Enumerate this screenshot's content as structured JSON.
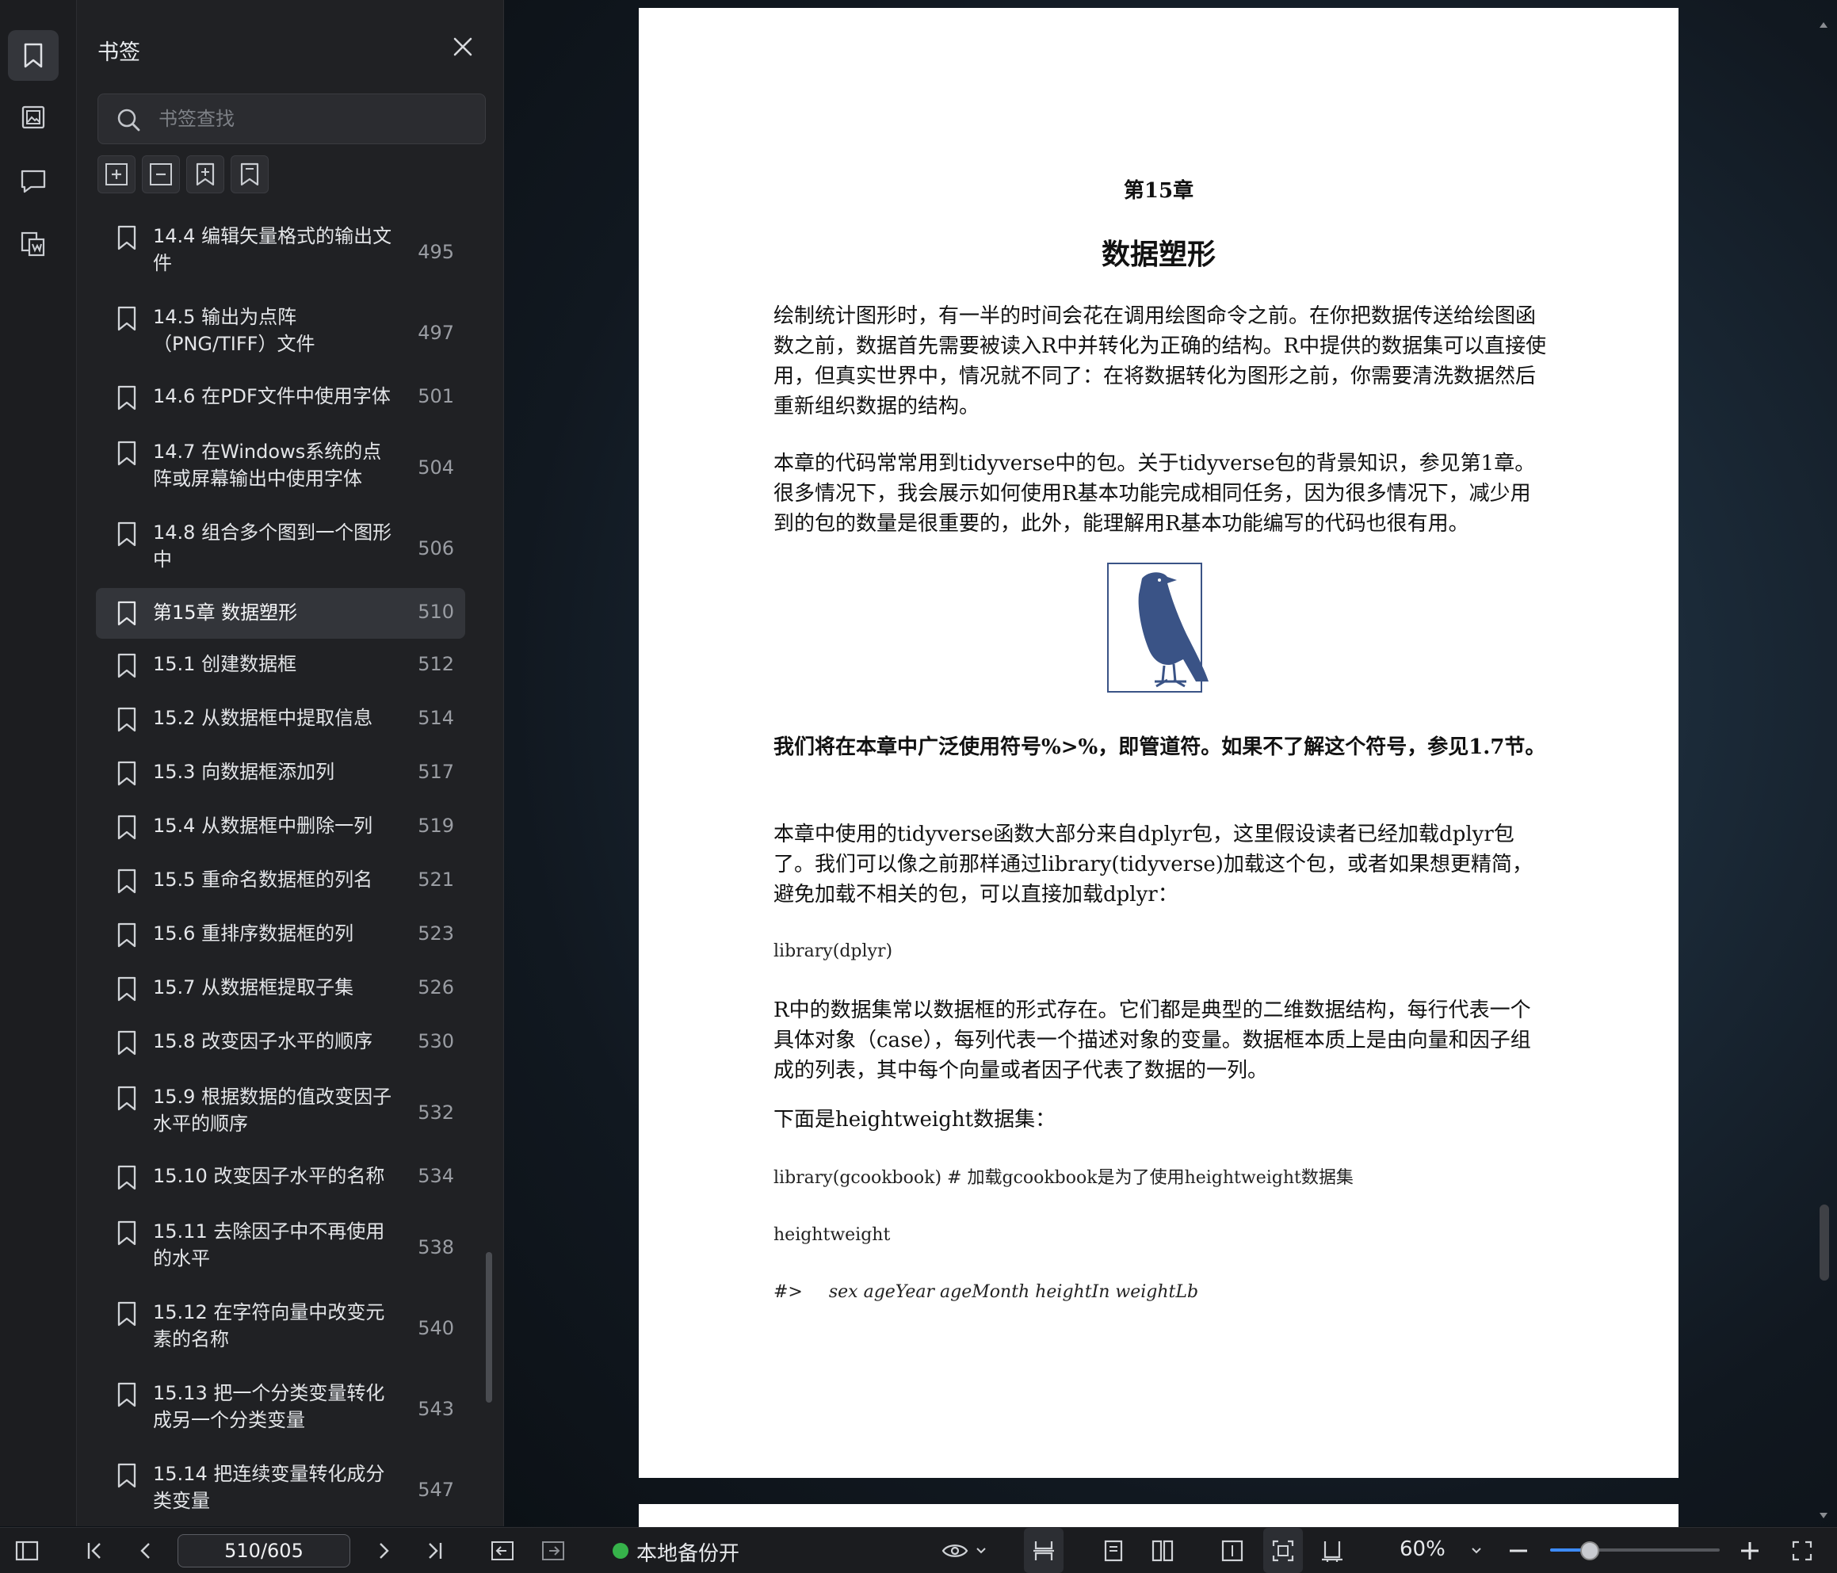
{
  "bookmark_panel": {
    "title": "书签",
    "search_placeholder": "书签查找",
    "items": [
      {
        "label": "14.4 编辑矢量格式的输出文件",
        "page": "495"
      },
      {
        "label": "14.5 输出为点阵（PNG/TIFF）文件",
        "page": "497"
      },
      {
        "label": "14.6 在PDF文件中使用字体",
        "page": "501"
      },
      {
        "label": "14.7 在Windows系统的点阵或屏幕输出中使用字体",
        "page": "504"
      },
      {
        "label": "14.8 组合多个图到一个图形中",
        "page": "506"
      },
      {
        "label": "第15章 数据塑形",
        "page": "510"
      },
      {
        "label": "15.1 创建数据框",
        "page": "512"
      },
      {
        "label": "15.2 从数据框中提取信息",
        "page": "514"
      },
      {
        "label": "15.3 向数据框添加列",
        "page": "517"
      },
      {
        "label": "15.4 从数据框中删除一列",
        "page": "519"
      },
      {
        "label": "15.5 重命名数据框的列名",
        "page": "521"
      },
      {
        "label": "15.6 重排序数据框的列",
        "page": "523"
      },
      {
        "label": "15.7 从数据框提取子集",
        "page": "526"
      },
      {
        "label": "15.8 改变因子水平的顺序",
        "page": "530"
      },
      {
        "label": "15.9 根据数据的值改变因子水平的顺序",
        "page": "532"
      },
      {
        "label": "15.10 改变因子水平的名称",
        "page": "534"
      },
      {
        "label": "15.11 去除因子中不再使用的水平",
        "page": "538"
      },
      {
        "label": "15.12 在字符向量中改变元素的名称",
        "page": "540"
      },
      {
        "label": "15.13 把一个分类变量转化成另一个分类变量",
        "page": "543"
      },
      {
        "label": "15.14 把连续变量转化成分类变量",
        "page": "547"
      }
    ]
  },
  "document": {
    "chapter": "第15章",
    "title": "数据塑形",
    "para1": "绘制统计图形时，有一半的时间会花在调用绘图命令之前。在你把数据传送给绘图函数之前，数据首先需要被读入R中并转化为正确的结构。R中提供的数据集可以直接使用，但真实世界中，情况就不同了：在将数据转化为图形之前，你需要清洗数据然后重新组织数据的结构。",
    "para2": "本章的代码常常用到tidyverse中的包。关于tidyverse包的背景知识，参见第1章。很多情况下，我会展示如何使用R基本功能完成相同任务，因为很多情况下，减少用到的包的数量是很重要的，此外，能理解用R基本功能编写的代码也很有用。",
    "para3_bold": "我们将在本章中广泛使用符号%>%，即管道符。如果不了解这个符号，参见1.7节。",
    "para4": "本章中使用的tidyverse函数大部分来自dplyr包，这里假设读者已经加载dplyr包了。我们可以像之前那样通过library(tidyverse)加载这个包，或者如果想更精简，避免加载不相关的包，可以直接加载dplyr：",
    "code1": "library(dplyr)",
    "para5": "R中的数据集常以数据框的形式存在。它们都是典型的二维数据结构，每行代表一个具体对象（case），每列代表一个描述对象的变量。数据框本质上是由向量和因子组成的列表，其中每个向量或者因子代表了数据的一列。",
    "para6": "下面是heightweight数据集：",
    "code2": "library(gcookbook) # 加载gcookbook是为了使用heightweight数据集",
    "code3": "heightweight",
    "code4_prompt": "#>",
    "code4_cols": "sex ageYear ageMonth heightIn weightLb"
  },
  "statusbar": {
    "page_indicator": "510/605",
    "backup_label": "本地备份开",
    "zoom_label": "60%",
    "zoom_level_fraction": 0.23
  },
  "colors": {
    "accent": "#3d8bff",
    "backup_status": "#36b24a",
    "bird_logo": "#3a5386"
  }
}
